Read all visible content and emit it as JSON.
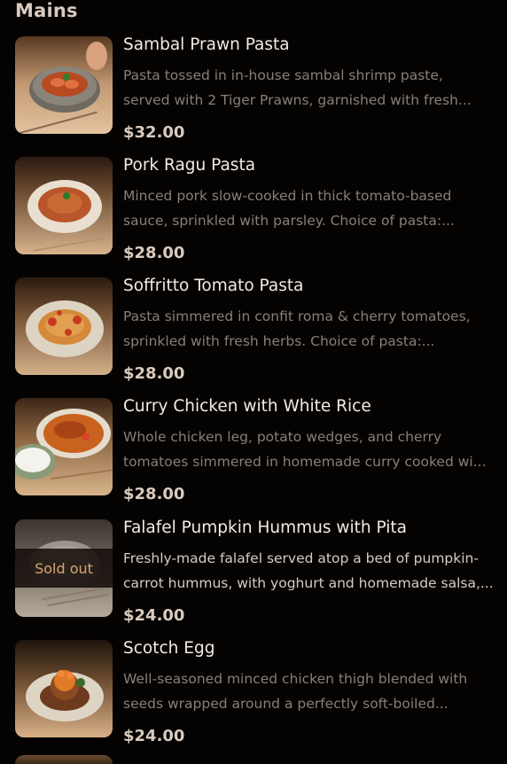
{
  "section": {
    "title": "Mains"
  },
  "items": [
    {
      "name": "Sambal Prawn Pasta",
      "description": "Pasta tossed in in-house sambal shrimp paste, served with 2 Tiger Prawns, garnished with fresh...",
      "price": "$32.00",
      "sold_out": false
    },
    {
      "name": "Pork Ragu Pasta",
      "description": "Minced pork slow-cooked in thick tomato-based sauce, sprinkled with parsley. Choice of pasta:...",
      "price": "$28.00",
      "sold_out": false
    },
    {
      "name": "Soffritto Tomato Pasta",
      "description": "Pasta simmered in confit roma & cherry tomatoes, sprinkled with fresh herbs. Choice of pasta:...",
      "price": "$28.00",
      "sold_out": false
    },
    {
      "name": "Curry Chicken with White Rice",
      "description": "Whole chicken leg, potato wedges, and cherry tomatoes simmered in homemade curry cooked wi...",
      "price": "$28.00",
      "sold_out": false
    },
    {
      "name": "Falafel Pumpkin Hummus with Pita",
      "description": "Freshly-made falafel served atop a bed of pumpkin-carrot hummus, with yoghurt and homemade salsa,...",
      "price": "$24.00",
      "sold_out": true,
      "sold_out_label": "Sold out"
    },
    {
      "name": "Scotch Egg",
      "description": "Well-seasoned minced chicken thigh blended with seeds wrapped around a perfectly soft-boiled...",
      "price": "$24.00",
      "sold_out": false
    }
  ],
  "colors": {
    "background": "#050302",
    "title": "#f4ebe2",
    "description_muted": "#8a7f76",
    "description_available": "#d7ccc2",
    "price": "#d8cbbf",
    "sold_out_text": "#d8a56e"
  }
}
